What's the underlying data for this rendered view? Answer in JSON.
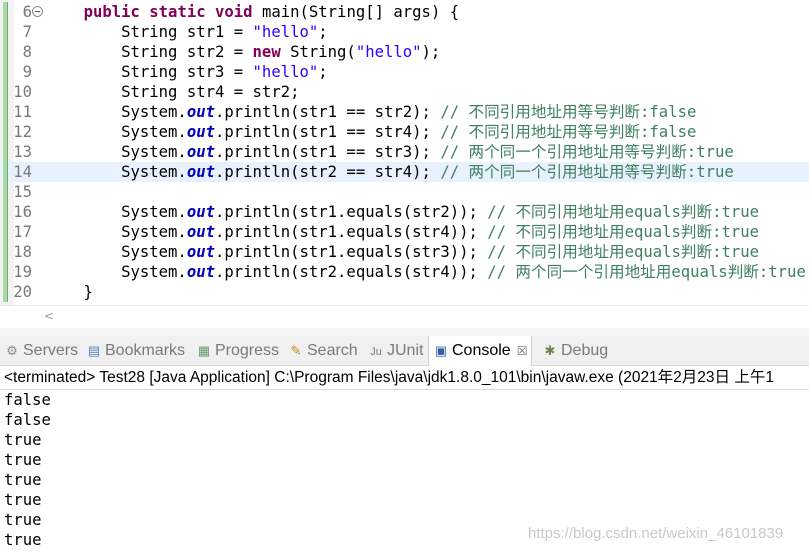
{
  "editor": {
    "current_line": "14",
    "lines": [
      {
        "num": "6",
        "fold": true,
        "parts": [
          [
            "",
            "    "
          ],
          [
            "kw",
            "public static void"
          ],
          [
            "",
            " main(String[] args) {"
          ]
        ]
      },
      {
        "num": "7",
        "parts": [
          [
            "",
            "        String str1 = "
          ],
          [
            "str",
            "\"hello\""
          ],
          [
            "",
            ";"
          ]
        ]
      },
      {
        "num": "8",
        "parts": [
          [
            "",
            "        String str2 = "
          ],
          [
            "kw",
            "new"
          ],
          [
            "",
            " String("
          ],
          [
            "str",
            "\"hello\""
          ],
          [
            "",
            ");"
          ]
        ]
      },
      {
        "num": "9",
        "parts": [
          [
            "",
            "        String str3 = "
          ],
          [
            "str",
            "\"hello\""
          ],
          [
            "",
            ";"
          ]
        ]
      },
      {
        "num": "10",
        "parts": [
          [
            "",
            "        String str4 = str2;"
          ]
        ]
      },
      {
        "num": "11",
        "parts": [
          [
            "",
            "        System."
          ],
          [
            "fld",
            "out"
          ],
          [
            "",
            ".println(str1 == str2); "
          ],
          [
            "cm",
            "// 不同引用地址用等号判断:false"
          ]
        ]
      },
      {
        "num": "12",
        "parts": [
          [
            "",
            "        System."
          ],
          [
            "fld",
            "out"
          ],
          [
            "",
            ".println(str1 == str4); "
          ],
          [
            "cm",
            "// 不同引用地址用等号判断:false"
          ]
        ]
      },
      {
        "num": "13",
        "parts": [
          [
            "",
            "        System."
          ],
          [
            "fld",
            "out"
          ],
          [
            "",
            ".println(str1 == str3); "
          ],
          [
            "cm",
            "// 两个同一个引用地址用等号判断:true"
          ]
        ]
      },
      {
        "num": "14",
        "parts": [
          [
            "",
            "        System."
          ],
          [
            "fld",
            "out"
          ],
          [
            "",
            ".println(str2 == str4); "
          ],
          [
            "cm",
            "// 两个同一个引用地址用等号判断:true"
          ]
        ]
      },
      {
        "num": "15",
        "parts": []
      },
      {
        "num": "16",
        "parts": [
          [
            "",
            "        System."
          ],
          [
            "fld",
            "out"
          ],
          [
            "",
            ".println(str1.equals(str2)); "
          ],
          [
            "cm",
            "// 不同引用地址用equals判断:true"
          ]
        ]
      },
      {
        "num": "17",
        "parts": [
          [
            "",
            "        System."
          ],
          [
            "fld",
            "out"
          ],
          [
            "",
            ".println(str1.equals(str4)); "
          ],
          [
            "cm",
            "// 不同引用地址用equals判断:true"
          ]
        ]
      },
      {
        "num": "18",
        "parts": [
          [
            "",
            "        System."
          ],
          [
            "fld",
            "out"
          ],
          [
            "",
            ".println(str1.equals(str3)); "
          ],
          [
            "cm",
            "// 不同引用地址用equals判断:true"
          ]
        ]
      },
      {
        "num": "19",
        "parts": [
          [
            "",
            "        System."
          ],
          [
            "fld",
            "out"
          ],
          [
            "",
            ".println(str2.equals(str4)); "
          ],
          [
            "cm",
            "// 两个同一个引用地址用equals判断:true"
          ]
        ]
      },
      {
        "num": "20",
        "parts": [
          [
            "",
            "    }"
          ]
        ]
      },
      {
        "num": "",
        "parts": [
          [
            "",
            "}"
          ]
        ]
      }
    ]
  },
  "scroll": {
    "left_arrow": "<"
  },
  "tabs": [
    {
      "key": "servers",
      "label": "Servers",
      "icon": "servers-icon",
      "glyph": "⚙",
      "color": "#8a8a8a"
    },
    {
      "key": "bookmarks",
      "label": "Bookmarks",
      "icon": "bookmarks-icon",
      "glyph": "▤",
      "color": "#5b7fb6"
    },
    {
      "key": "progress",
      "label": "Progress",
      "icon": "progress-icon",
      "glyph": "▦",
      "color": "#6a9a6a"
    },
    {
      "key": "search",
      "label": "Search",
      "icon": "search-icon",
      "glyph": "✎",
      "color": "#c08a30"
    },
    {
      "key": "junit",
      "label": "JUnit",
      "icon": "junit-icon",
      "glyph": "Ju",
      "color": "#7a7a7a"
    },
    {
      "key": "console",
      "label": "Console",
      "icon": "console-icon",
      "glyph": "▣",
      "color": "#2f5fa0",
      "active": true,
      "close": "☒"
    },
    {
      "key": "debug",
      "label": "Debug",
      "icon": "debug-icon",
      "glyph": "✱",
      "color": "#6a8a4a"
    }
  ],
  "console": {
    "status": "<terminated> Test28 [Java Application] C:\\Program Files\\java\\jdk1.8.0_101\\bin\\javaw.exe  (2021年2月23日 上午1",
    "output": [
      "false",
      "false",
      "true",
      "true",
      "true",
      "true",
      "true",
      "true"
    ]
  },
  "watermark": "https://blog.csdn.net/weixin_46101839"
}
